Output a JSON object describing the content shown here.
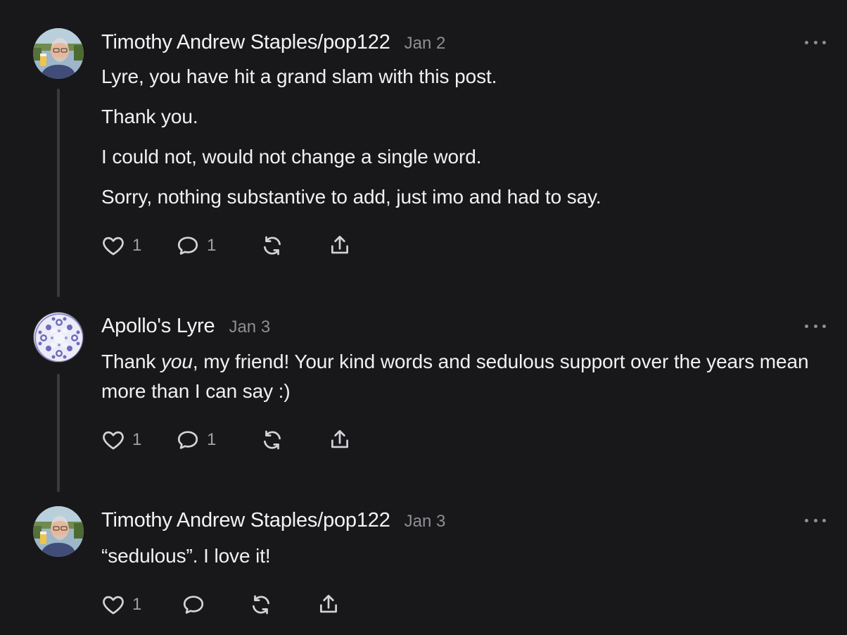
{
  "comments": [
    {
      "author": "Timothy Andrew Staples/pop122",
      "date": "Jan 2",
      "paragraphs": [
        "Lyre, you have hit a grand slam with this post.",
        "Thank you.",
        "I could not, would not change a single word.",
        "Sorry, nothing substantive to add, just imo and had to say."
      ],
      "likes": "1",
      "replies": "1",
      "avatar_icon": "profile-photo",
      "actions": {
        "like_icon": "heart-icon",
        "reply_icon": "speech-bubble-icon",
        "restack_icon": "restack-icon",
        "share_icon": "share-icon"
      }
    },
    {
      "author": "Apollo's Lyre",
      "date": "Jan 3",
      "body_pre": "Thank ",
      "body_em": "you",
      "body_post": ", my friend! Your kind words and sedulous support over the years mean more than I can say :)",
      "likes": "1",
      "replies": "1",
      "avatar_icon": "fractal-pattern-avatar"
    },
    {
      "author": "Timothy Andrew Staples/pop122",
      "date": "Jan 3",
      "body": "“sedulous”. I love it!",
      "likes": "1",
      "avatar_icon": "profile-photo"
    }
  ],
  "colors": {
    "background": "#18181b",
    "text": "#f1f1f1",
    "muted": "#8e8e93",
    "thread_line": "#3a3a3e"
  }
}
